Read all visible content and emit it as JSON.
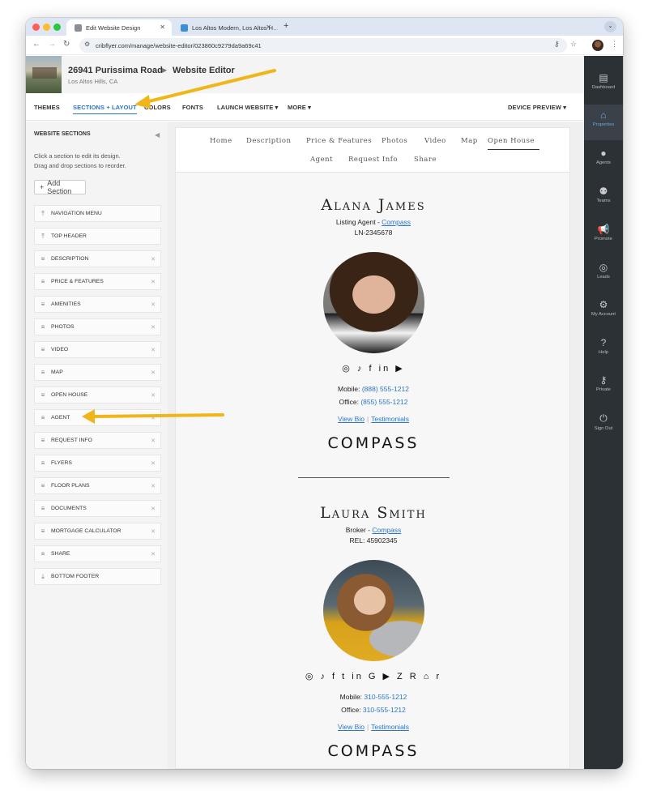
{
  "browser": {
    "tabs": [
      {
        "title": "Edit Website Design",
        "active": true
      },
      {
        "title": "Los Altos Modern, Los Altos H…",
        "active": false
      }
    ],
    "url": "cribflyer.com/manage/website-editor/023860c9279da9a69c41"
  },
  "header": {
    "property": "26941 Purissima Road",
    "location": "Los Altos Hills, CA",
    "editor": "Website Editor"
  },
  "menu": {
    "themes": "THEMES",
    "sections_layout": "SECTIONS + LAYOUT",
    "colors": "COLORS",
    "fonts": "FONTS",
    "launch": "LAUNCH WEBSITE",
    "more": "MORE",
    "device_preview": "DEVICE PREVIEW"
  },
  "sidebar": {
    "title": "WEBSITE SECTIONS",
    "hint_line1": "Click a section to edit its design.",
    "hint_line2": "Drag and drop sections to reorder.",
    "add_section": "Add Section",
    "sections": [
      "NAVIGATION MENU",
      "TOP HEADER",
      "DESCRIPTION",
      "PRICE & FEATURES",
      "AMENITIES",
      "PHOTOS",
      "VIDEO",
      "MAP",
      "OPEN HOUSE",
      "AGENT",
      "REQUEST INFO",
      "FLYERS",
      "FLOOR PLANS",
      "DOCUMENTS",
      "MORTGAGE CALCULATOR",
      "SHARE",
      "BOTTOM FOOTER"
    ]
  },
  "preview": {
    "nav": [
      "Home",
      "Description",
      "Price & Features",
      "Photos",
      "Video",
      "Map",
      "Open House",
      "Agent",
      "Request Info",
      "Share"
    ],
    "agents": [
      {
        "name": "Alana James",
        "role": "Listing Agent - ",
        "company": "Compass",
        "license": "LN-2345678",
        "social": "◎ ♪ f in ▶",
        "mobile_label": "Mobile: ",
        "mobile": "(888) 555-1212",
        "office_label": "Office: ",
        "office": "(855) 555-1212",
        "view_bio": "View Bio",
        "testimonials": "Testimonials",
        "logo": "COMPASS"
      },
      {
        "name": "Laura Smith",
        "role": "Broker - ",
        "company": "Compass",
        "license": "REL: 45902345",
        "social": "◎ ♪ f t in G ▶ Z R ⌂ r",
        "mobile_label": "Mobile: ",
        "mobile": "310-555-1212",
        "office_label": "Office: ",
        "office": "310-555-1212",
        "view_bio": "View Bio",
        "testimonials": "Testimonials",
        "logo": "COMPASS"
      }
    ]
  },
  "right_sidebar": [
    "Dashboard",
    "Properties",
    "Agents",
    "Teams",
    "Promote",
    "Leads",
    "My Account",
    "Help",
    "Private",
    "Sign Out"
  ],
  "colors": {
    "accent": "#2b76c8",
    "dark_sidebar": "#2c3136",
    "arrow": "#f0b619"
  }
}
